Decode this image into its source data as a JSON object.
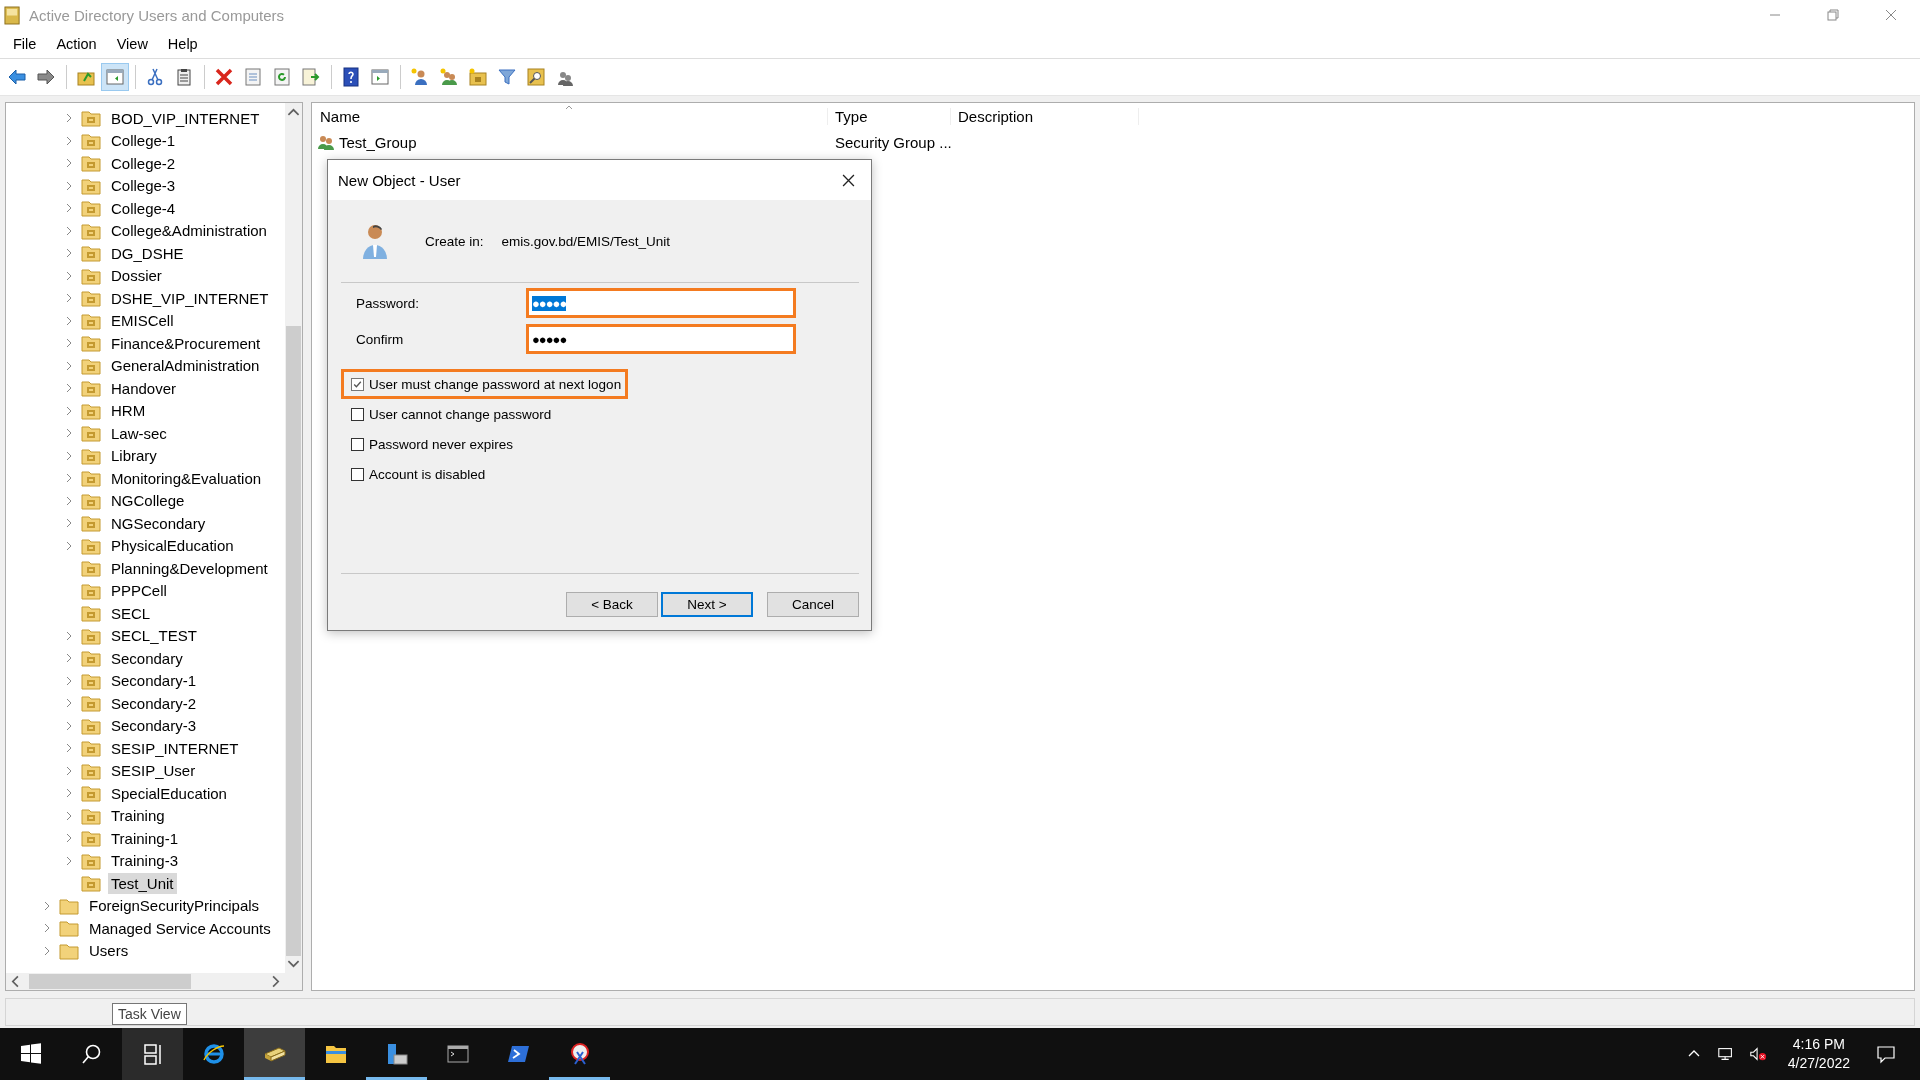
{
  "window": {
    "title": "Active Directory Users and Computers"
  },
  "menu": [
    {
      "label": "File"
    },
    {
      "label": "Action"
    },
    {
      "label": "View"
    },
    {
      "label": "Help"
    }
  ],
  "toolbar_groups": [
    {
      "buttons": [
        {
          "kind": "back",
          "pressed": false
        },
        {
          "kind": "forward",
          "pressed": false
        }
      ]
    },
    {
      "buttons": [
        {
          "kind": "up",
          "pressed": false
        },
        {
          "kind": "console_tree",
          "pressed": true
        }
      ]
    },
    {
      "buttons": [
        {
          "kind": "cut",
          "pressed": false
        },
        {
          "kind": "paste",
          "pressed": false
        }
      ]
    },
    {
      "buttons": [
        {
          "kind": "delete",
          "pressed": false
        },
        {
          "kind": "properties",
          "pressed": false
        },
        {
          "kind": "refresh",
          "pressed": false
        },
        {
          "kind": "export",
          "pressed": false
        }
      ]
    },
    {
      "buttons": [
        {
          "kind": "help",
          "pressed": false
        },
        {
          "kind": "action_pane",
          "pressed": false
        }
      ]
    },
    {
      "buttons": [
        {
          "kind": "new_user",
          "pressed": false
        },
        {
          "kind": "new_group",
          "pressed": false
        },
        {
          "kind": "new_ou",
          "pressed": false
        },
        {
          "kind": "filter",
          "pressed": false
        },
        {
          "kind": "find",
          "pressed": false
        },
        {
          "kind": "add_to_group",
          "pressed": false
        }
      ]
    }
  ],
  "tree": {
    "ou_items": [
      {
        "label": "BOD_VIP_INTERNET",
        "expandable": true,
        "selected": false
      },
      {
        "label": "College-1",
        "expandable": true,
        "selected": false
      },
      {
        "label": "College-2",
        "expandable": true,
        "selected": false
      },
      {
        "label": "College-3",
        "expandable": true,
        "selected": false
      },
      {
        "label": "College-4",
        "expandable": true,
        "selected": false
      },
      {
        "label": "College&Administration",
        "expandable": true,
        "selected": false
      },
      {
        "label": "DG_DSHE",
        "expandable": true,
        "selected": false
      },
      {
        "label": "Dossier",
        "expandable": true,
        "selected": false
      },
      {
        "label": "DSHE_VIP_INTERNET",
        "expandable": true,
        "selected": false
      },
      {
        "label": "EMISCell",
        "expandable": true,
        "selected": false
      },
      {
        "label": "Finance&Procurement",
        "expandable": true,
        "selected": false
      },
      {
        "label": "GeneralAdministration",
        "expandable": true,
        "selected": false
      },
      {
        "label": "Handover",
        "expandable": true,
        "selected": false
      },
      {
        "label": "HRM",
        "expandable": true,
        "selected": false
      },
      {
        "label": "Law-sec",
        "expandable": true,
        "selected": false
      },
      {
        "label": "Library",
        "expandable": true,
        "selected": false
      },
      {
        "label": "Monitoring&Evaluation",
        "expandable": true,
        "selected": false
      },
      {
        "label": "NGCollege",
        "expandable": true,
        "selected": false
      },
      {
        "label": "NGSecondary",
        "expandable": true,
        "selected": false
      },
      {
        "label": "PhysicalEducation",
        "expandable": true,
        "selected": false
      },
      {
        "label": "Planning&Development",
        "expandable": false,
        "selected": false
      },
      {
        "label": "PPPCell",
        "expandable": false,
        "selected": false
      },
      {
        "label": "SECL",
        "expandable": false,
        "selected": false
      },
      {
        "label": "SECL_TEST",
        "expandable": true,
        "selected": false
      },
      {
        "label": "Secondary",
        "expandable": true,
        "selected": false
      },
      {
        "label": "Secondary-1",
        "expandable": true,
        "selected": false
      },
      {
        "label": "Secondary-2",
        "expandable": true,
        "selected": false
      },
      {
        "label": "Secondary-3",
        "expandable": true,
        "selected": false
      },
      {
        "label": "SESIP_INTERNET",
        "expandable": true,
        "selected": false
      },
      {
        "label": "SESIP_User",
        "expandable": true,
        "selected": false
      },
      {
        "label": "SpecialEducation",
        "expandable": true,
        "selected": false
      },
      {
        "label": "Training",
        "expandable": true,
        "selected": false
      },
      {
        "label": "Training-1",
        "expandable": true,
        "selected": false
      },
      {
        "label": "Training-3",
        "expandable": true,
        "selected": false
      },
      {
        "label": "Test_Unit",
        "expandable": false,
        "selected": true
      }
    ],
    "root_items": [
      {
        "label": "ForeignSecurityPrincipals",
        "expandable": true,
        "selected": false
      },
      {
        "label": "Managed Service Accounts",
        "expandable": true,
        "selected": false
      },
      {
        "label": "Users",
        "expandable": true,
        "selected": false
      }
    ]
  },
  "list": {
    "columns": [
      "Name",
      "Type",
      "Description"
    ],
    "rows": [
      {
        "name": "Test_Group",
        "type": "Security Group ..."
      }
    ]
  },
  "dialog": {
    "title": "New Object - User",
    "create_in_label": "Create in:",
    "create_in_path": "emis.gov.bd/EMIS/Test_Unit",
    "fields": [
      {
        "label": "Password:",
        "value": "●●●●●",
        "text_selected": true,
        "highlighted": true
      },
      {
        "label": "Confirm",
        "value": "●●●●●",
        "text_selected": false,
        "highlighted": true
      }
    ],
    "options": [
      {
        "label": "User must change password at next logon",
        "checked": true,
        "highlighted": true
      },
      {
        "label": "User cannot change password",
        "checked": false,
        "highlighted": false
      },
      {
        "label": "Password never expires",
        "checked": false,
        "highlighted": false
      },
      {
        "label": "Account is disabled",
        "checked": false,
        "highlighted": false
      }
    ],
    "buttons": [
      {
        "label": "< Back",
        "default": false
      },
      {
        "label": "Next >",
        "default": true
      },
      {
        "label": "Cancel",
        "default": false
      }
    ]
  },
  "tooltip": "Task View",
  "taskbar": {
    "apps": [
      {
        "kind": "start",
        "active": false,
        "running": false,
        "hovered": false
      },
      {
        "kind": "search",
        "active": false,
        "running": false,
        "hovered": false
      },
      {
        "kind": "task_view",
        "active": false,
        "running": false,
        "hovered": true
      },
      {
        "kind": "browser",
        "active": false,
        "running": false,
        "hovered": false
      },
      {
        "kind": "directory",
        "active": true,
        "running": true,
        "hovered": false
      },
      {
        "kind": "explorer",
        "active": false,
        "running": false,
        "hovered": false
      },
      {
        "kind": "server_manager",
        "active": false,
        "running": true,
        "hovered": false
      },
      {
        "kind": "terminal",
        "active": false,
        "running": false,
        "hovered": false
      },
      {
        "kind": "powershell",
        "active": false,
        "running": false,
        "hovered": false
      },
      {
        "kind": "snipping",
        "active": false,
        "running": true,
        "hovered": false
      }
    ],
    "clock": {
      "time": "4:16 PM",
      "date": "4/27/2022"
    }
  }
}
